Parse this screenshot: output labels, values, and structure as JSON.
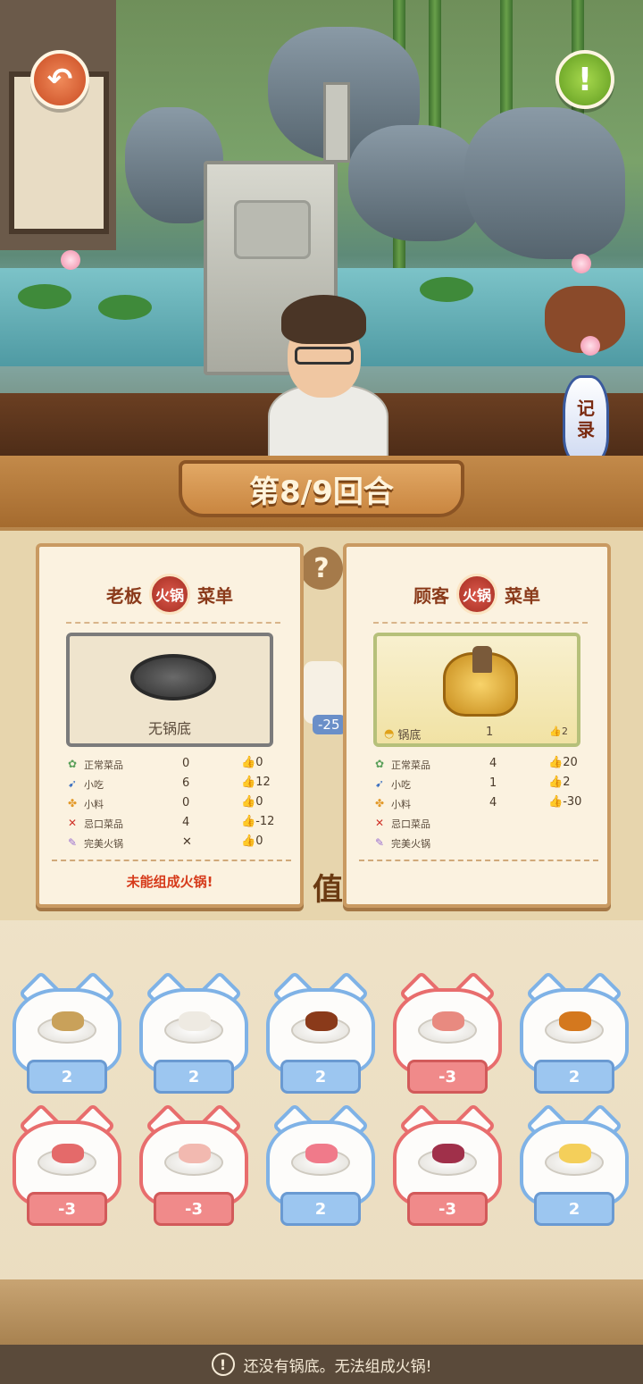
{
  "round": {
    "text": "第8/9回合"
  },
  "buttons": {
    "back_icon": "↶",
    "info_icon": "!"
  },
  "record": {
    "line1": "记",
    "line2": "录"
  },
  "boss_menu": {
    "word_left": "老板",
    "badge": "火锅",
    "word_right": "菜单",
    "dish_caption": "无锅底",
    "stats": [
      {
        "icon": "✿",
        "label": "正常菜品",
        "value": "0",
        "like": "0",
        "color": "#5aa05a"
      },
      {
        "icon": "➹",
        "label": "小吃",
        "value": "6",
        "like": "12",
        "color": "#3a6fc0"
      },
      {
        "icon": "✤",
        "label": "小料",
        "value": "0",
        "like": "0",
        "color": "#e39a2a"
      },
      {
        "icon": "✕",
        "label": "忌口菜品",
        "value": "4",
        "like": "-12",
        "color": "#d0342a"
      },
      {
        "icon": "✎",
        "label": "完美火锅",
        "value": "✕",
        "like": "0",
        "color": "#9a6fd0"
      }
    ],
    "footer": "未能组成火锅!"
  },
  "customer_menu": {
    "word_left": "顾客",
    "badge": "火锅",
    "word_right": "菜单",
    "dish_label": "锅底",
    "dish_value": "1",
    "dish_like": "2",
    "stats": [
      {
        "icon": "✿",
        "label": "正常菜品",
        "value": "4",
        "like": "20",
        "color": "#5aa05a"
      },
      {
        "icon": "➹",
        "label": "小吃",
        "value": "1",
        "like": "2",
        "color": "#3a6fc0"
      },
      {
        "icon": "✤",
        "label": "小料",
        "value": "4",
        "like": "-30",
        "color": "#e39a2a"
      },
      {
        "icon": "✕",
        "label": "忌口菜品",
        "value": "",
        "like": "",
        "color": "#d0342a"
      },
      {
        "icon": "✎",
        "label": "完美火锅",
        "value": "",
        "like": "",
        "color": "#9a6fd0"
      }
    ]
  },
  "board": {
    "help_icon": "?",
    "partial_score": "-25",
    "value_char": "值"
  },
  "ingredients": [
    {
      "score": "2",
      "tone": "blue",
      "food_color": "#c9a15a"
    },
    {
      "score": "2",
      "tone": "blue",
      "food_color": "#eeeae2"
    },
    {
      "score": "2",
      "tone": "blue",
      "food_color": "#8a3a1a"
    },
    {
      "score": "-3",
      "tone": "red",
      "food_color": "#e88a80"
    },
    {
      "score": "2",
      "tone": "blue",
      "food_color": "#d4781e"
    },
    {
      "score": "-3",
      "tone": "red",
      "food_color": "#e46a6a"
    },
    {
      "score": "-3",
      "tone": "red",
      "food_color": "#f2b9b0"
    },
    {
      "score": "2",
      "tone": "blue",
      "food_color": "#f07a8a"
    },
    {
      "score": "-3",
      "tone": "red",
      "food_color": "#a0304a"
    },
    {
      "score": "2",
      "tone": "blue",
      "food_color": "#f4cf5a"
    }
  ],
  "status": {
    "icon": "!",
    "text": "还没有锅底。无法组成火锅!"
  }
}
